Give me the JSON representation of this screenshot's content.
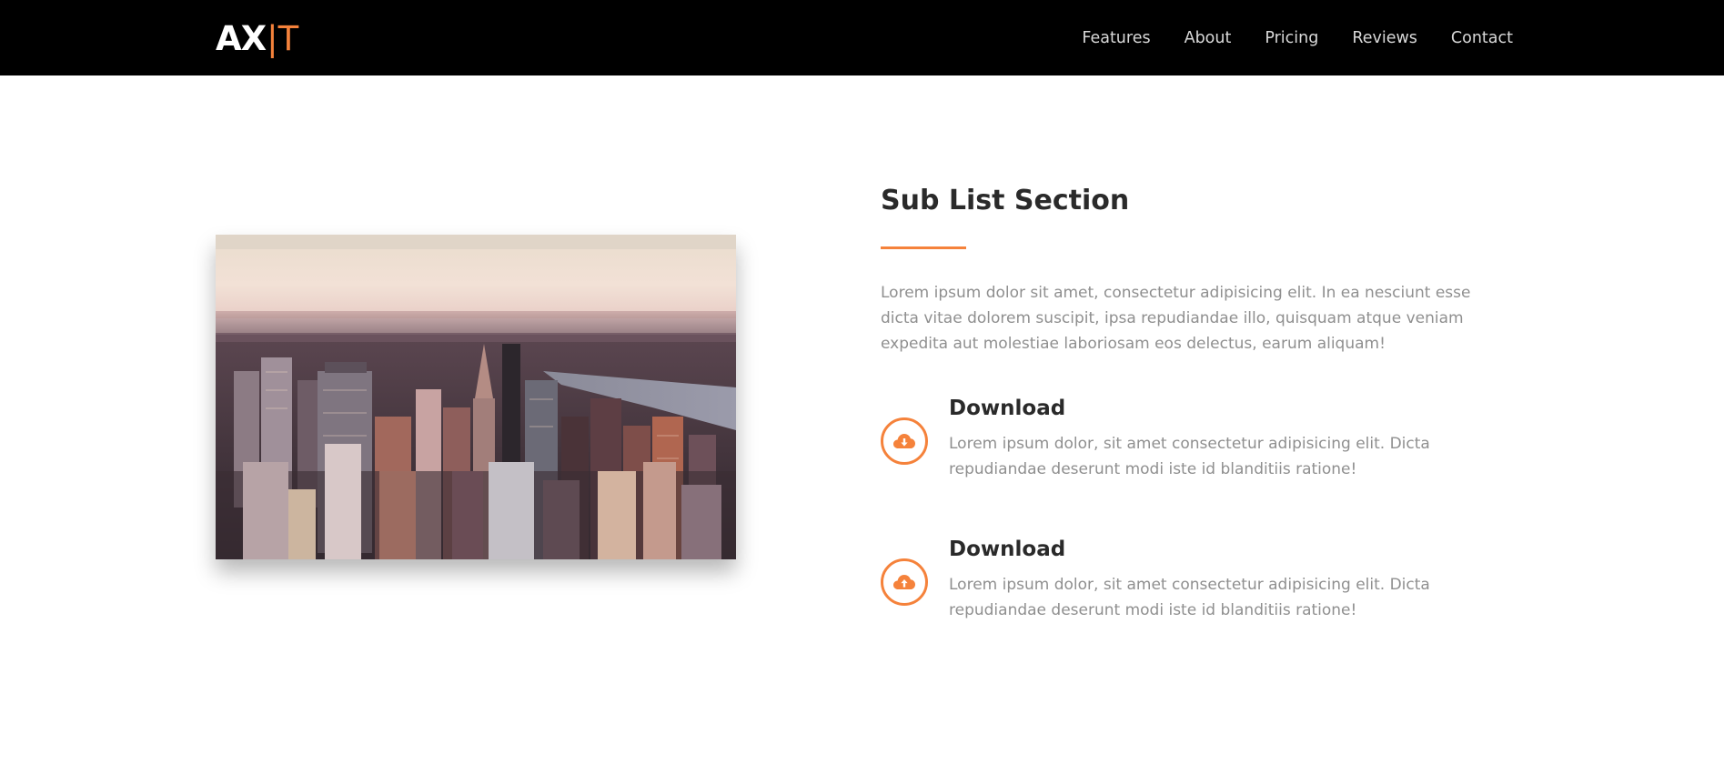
{
  "header": {
    "logo": {
      "main": "AX",
      "separator": "|",
      "accent": "T"
    },
    "nav": [
      {
        "label": "Features"
      },
      {
        "label": "About"
      },
      {
        "label": "Pricing"
      },
      {
        "label": "Reviews"
      },
      {
        "label": "Contact"
      }
    ]
  },
  "image": {
    "subject": "city-skyline-photo"
  },
  "section": {
    "title": "Sub List Section",
    "intro": "Lorem ipsum dolor sit amet, consectetur adipisicing elit. In ea nesciunt esse dicta vitae dolorem suscipit, ipsa repudiandae illo, quisquam atque veniam expedita aut molestiae laboriosam eos delectus, earum aliquam!",
    "items": [
      {
        "icon": "cloud-download-icon",
        "title": "Download",
        "text": "Lorem ipsum dolor, sit amet consectetur adipisicing elit. Dicta repudiandae deserunt modi iste id blanditiis ratione!"
      },
      {
        "icon": "cloud-upload-icon",
        "title": "Download",
        "text": "Lorem ipsum dolor, sit amet consectetur adipisicing elit. Dicta repudiandae deserunt modi iste id blanditiis ratione!"
      }
    ]
  },
  "colors": {
    "accent": "#f5823b",
    "header_bg": "#000000",
    "heading": "#2a2a2a",
    "body_text": "#8f8f8f"
  }
}
